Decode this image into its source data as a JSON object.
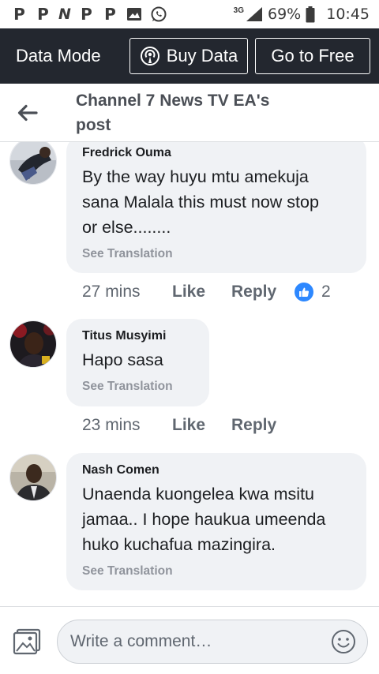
{
  "status_bar": {
    "left_icons": [
      "P",
      "P",
      "N",
      "P",
      "P"
    ],
    "icons": [
      "gallery-icon",
      "whatsapp-icon",
      "signal-icon",
      "battery-icon"
    ],
    "network": "3G",
    "battery": "69%",
    "time": "10:45"
  },
  "data_bar": {
    "label": "Data Mode",
    "buy_label": "Buy Data",
    "free_label": "Go to Free"
  },
  "header": {
    "title_line1": "Channel 7 News TV EA's",
    "title_line2": "post"
  },
  "comments": [
    {
      "author": "Fredrick Ouma",
      "text_lines": [
        "By the way huyu mtu amekuja",
        "sana Malala this must now stop",
        "or else........"
      ],
      "translate": "See Translation",
      "time": "27 mins",
      "like": "Like",
      "reply": "Reply",
      "reactions": "2"
    },
    {
      "author": "Titus Musyimi",
      "text_lines": [
        "Hapo sasa"
      ],
      "translate": "See Translation",
      "time": "23 mins",
      "like": "Like",
      "reply": "Reply"
    },
    {
      "author": "Nash Comen",
      "text_lines": [
        "Unaenda kuongelea kwa msitu",
        "jamaa.. I hope haukua umeenda",
        "huko kuchafua mazingira."
      ],
      "translate": "See Translation"
    }
  ],
  "composer": {
    "placeholder": "Write a comment…"
  },
  "colors": {
    "data_bar_bg": "#23272f",
    "bubble_bg": "#f0f2f5",
    "like_blue": "#2d88ff"
  }
}
